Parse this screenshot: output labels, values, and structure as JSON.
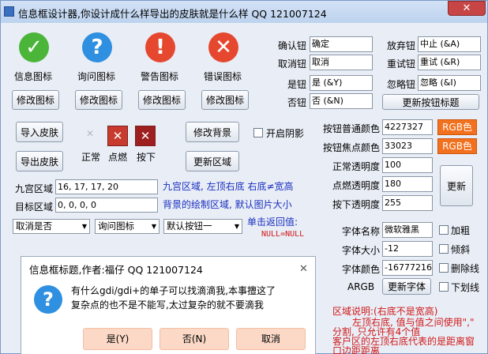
{
  "window": {
    "title": "信息框设计器,你设计成什么样导出的皮肤就是什么样 QQ 121007124",
    "close_glyph": "✕"
  },
  "icons": [
    {
      "label": "信息图标",
      "edit": "修改图标",
      "glyph": "✓",
      "color": "#4bb53a"
    },
    {
      "label": "询问图标",
      "edit": "修改图标",
      "glyph": "?",
      "color": "#2f8fe0"
    },
    {
      "label": "警告图标",
      "edit": "修改图标",
      "glyph": "!",
      "color": "#e6482f"
    },
    {
      "label": "错误图标",
      "edit": "修改图标",
      "glyph": "✕",
      "color": "#e6482f"
    }
  ],
  "btn_texts": {
    "confirm": {
      "label": "确认钮",
      "value": "确定"
    },
    "cancel": {
      "label": "取消钮",
      "value": "取消"
    },
    "yes": {
      "label": "是钮",
      "value": "是 (&Y)"
    },
    "no": {
      "label": "否钮",
      "value": "否 (&N)"
    },
    "abort": {
      "label": "放弃钮",
      "value": "中止 (&A)"
    },
    "retry": {
      "label": "重试钮",
      "value": "重试 (&R)"
    },
    "ignore": {
      "label": "忽略钮",
      "value": "忽略 (&I)"
    },
    "update_label": "更新按钮标题"
  },
  "skin": {
    "import": "导入皮肤",
    "export": "导出皮肤"
  },
  "state_boxes": {
    "normal": "正常",
    "hover": "点燃",
    "pressed": "按下",
    "glyph": "✕",
    "normal_glyph": "✕"
  },
  "bg": {
    "edit": "修改背景",
    "update_region": "更新区域",
    "shadow": "开启阴影"
  },
  "colors": {
    "normal_label": "按钮普通颜色",
    "normal_value": "4227327",
    "rgb": "RGB色",
    "focus_label": "按钮焦点颜色",
    "focus_value": "33023",
    "normal_alpha_label": "正常透明度",
    "normal_alpha": "100",
    "hover_alpha_label": "点燃透明度",
    "hover_alpha": "180",
    "pressed_alpha_label": "按下透明度",
    "pressed_alpha": "255",
    "update": "更新"
  },
  "regions": {
    "grid_label": "九宫区域",
    "grid_value": "16, 17, 17, 20",
    "grid_note": "九宫区域, 左顶右底    右底≠宽高",
    "target_label": "目标区域",
    "target_value": "0, 0, 0, 0",
    "target_note": "背景的绘制区域, 默认图片大小"
  },
  "selects": {
    "cancel_yes_no": "取消是否",
    "icon": "询问图标",
    "default_btn": "默认按钮一",
    "arrow": "▼"
  },
  "return_value": {
    "label": "单击返回值:",
    "value": "NULL=NULL"
  },
  "font": {
    "name_label": "字体名称",
    "name_value": "微软雅黑",
    "size_label": "字体大小",
    "size_value": "-12",
    "color_label": "字体颜色",
    "color_value": "-16777216",
    "bold": "加粗",
    "italic": "倾斜",
    "strike": "删除线",
    "underline": "下划线",
    "argb": "ARGB",
    "update": "更新字体"
  },
  "region_note": {
    "title": "区域说明:(右底不是宽高)",
    "line1": "左顶右底, 值与值之间使用\",\"",
    "line2": "分割, 只允许有4个值",
    "line3": "客户区的左顶右底代表的是距离窗",
    "line4": "口边距距离"
  },
  "dialog": {
    "title": "信息框标题,作者:福仔  QQ 121007124",
    "close": "✕",
    "line1": "有什么gdi/gdi+的单子可以找滴滴我,本事擅这了",
    "line2": "复杂点的也不是不能写,太过复杂的就不要滴我",
    "yes": "是(Y)",
    "no": "否(N)",
    "cancel": "取消",
    "icon_glyph": "?"
  }
}
